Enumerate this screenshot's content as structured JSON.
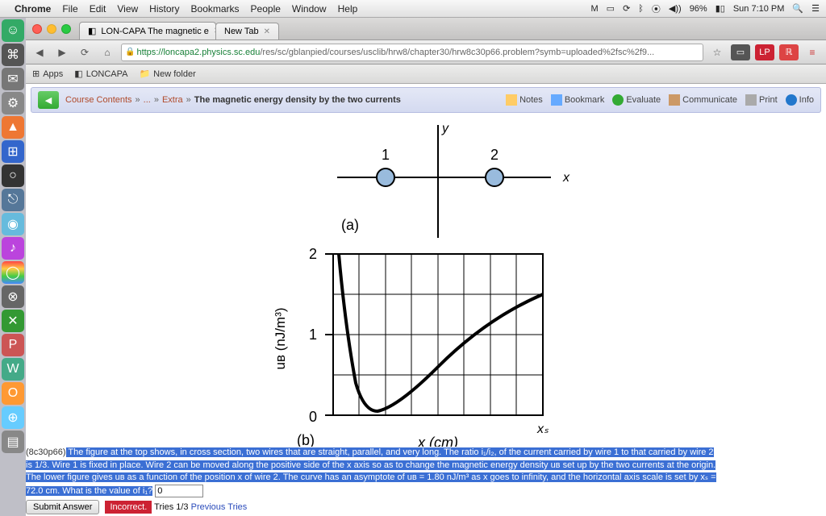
{
  "menubar": {
    "app": "Chrome",
    "items": [
      "File",
      "Edit",
      "View",
      "History",
      "Bookmarks",
      "People",
      "Window",
      "Help"
    ],
    "battery": "96%",
    "clock": "Sun 7:10 PM"
  },
  "tabs": {
    "t1": "LON-CAPA The magnetic e",
    "t2": "New Tab"
  },
  "url": {
    "scheme": "https",
    "host": "loncapa2.physics.sc.edu",
    "path": "/res/sc/gblanpied/courses/usclib/hrw8/chapter30/hrw8c30p66.problem?symb=uploaded%2fsc%2f9..."
  },
  "bookmarks": {
    "apps": "Apps",
    "b1": "LONCAPA",
    "b2": "New folder"
  },
  "breadcrumb": {
    "contents": "Course Contents",
    "dots": "...",
    "extra": "Extra",
    "title": "The magnetic energy density by the two currents",
    "notes": "Notes",
    "bookmark": "Bookmark",
    "evaluate": "Evaluate",
    "communicate": "Communicate",
    "print": "Print",
    "info": "Info"
  },
  "figure": {
    "label1": "1",
    "label2": "2",
    "xaxis": "x",
    "yaxis": "y",
    "a": "(a)",
    "b": "(b)",
    "ub": "uʙ (nJ/m³)",
    "xcm": "x (cm)",
    "xs": "xₛ",
    "t0": "0",
    "t1": "1",
    "t2": "2"
  },
  "problem": {
    "code": "(8c30p66)",
    "text1": " The figure at the top shows, in cross section, two wires that are straight, parallel, and very long. The ratio i₁/i₂, of the current carried by wire 1 to that carried by wire 2 ",
    "text2": "is 1/3. Wire 1 is fixed in place. Wire 2 can be moved along the positive side of the x axis so as to change the magnetic energy density uʙ set up by the two currents at the origin.",
    "text3": "The lower figure gives uʙ as a function of the position x of wire 2. The curve has an asymptote of uʙ = 1.80 nJ/m³ as x goes to infinity, and the horizontal axis scale is set by xₛ = ",
    "text4": "72.0 cm. What is the value of i₁?",
    "input_value": "0",
    "submit": "Submit Answer",
    "incorrect": "Incorrect.",
    "tries": " Tries 1/3 ",
    "prev": "Previous Tries"
  },
  "chart_data": {
    "type": "line",
    "title": "",
    "xlabel": "x (cm)",
    "ylabel": "u_B (nJ/m^3)",
    "xlim": [
      0,
      72.0
    ],
    "ylim": [
      0,
      2.2
    ],
    "yticks": [
      0,
      1,
      2
    ],
    "x": [
      2,
      4,
      6,
      8,
      12,
      16,
      20,
      28,
      36,
      44,
      52,
      60,
      68,
      72
    ],
    "values": [
      2.2,
      1.3,
      0.6,
      0.25,
      0.05,
      0.1,
      0.25,
      0.55,
      0.85,
      1.1,
      1.3,
      1.48,
      1.6,
      1.65
    ],
    "asymptote": 1.8,
    "xs_label_value": 72.0
  }
}
